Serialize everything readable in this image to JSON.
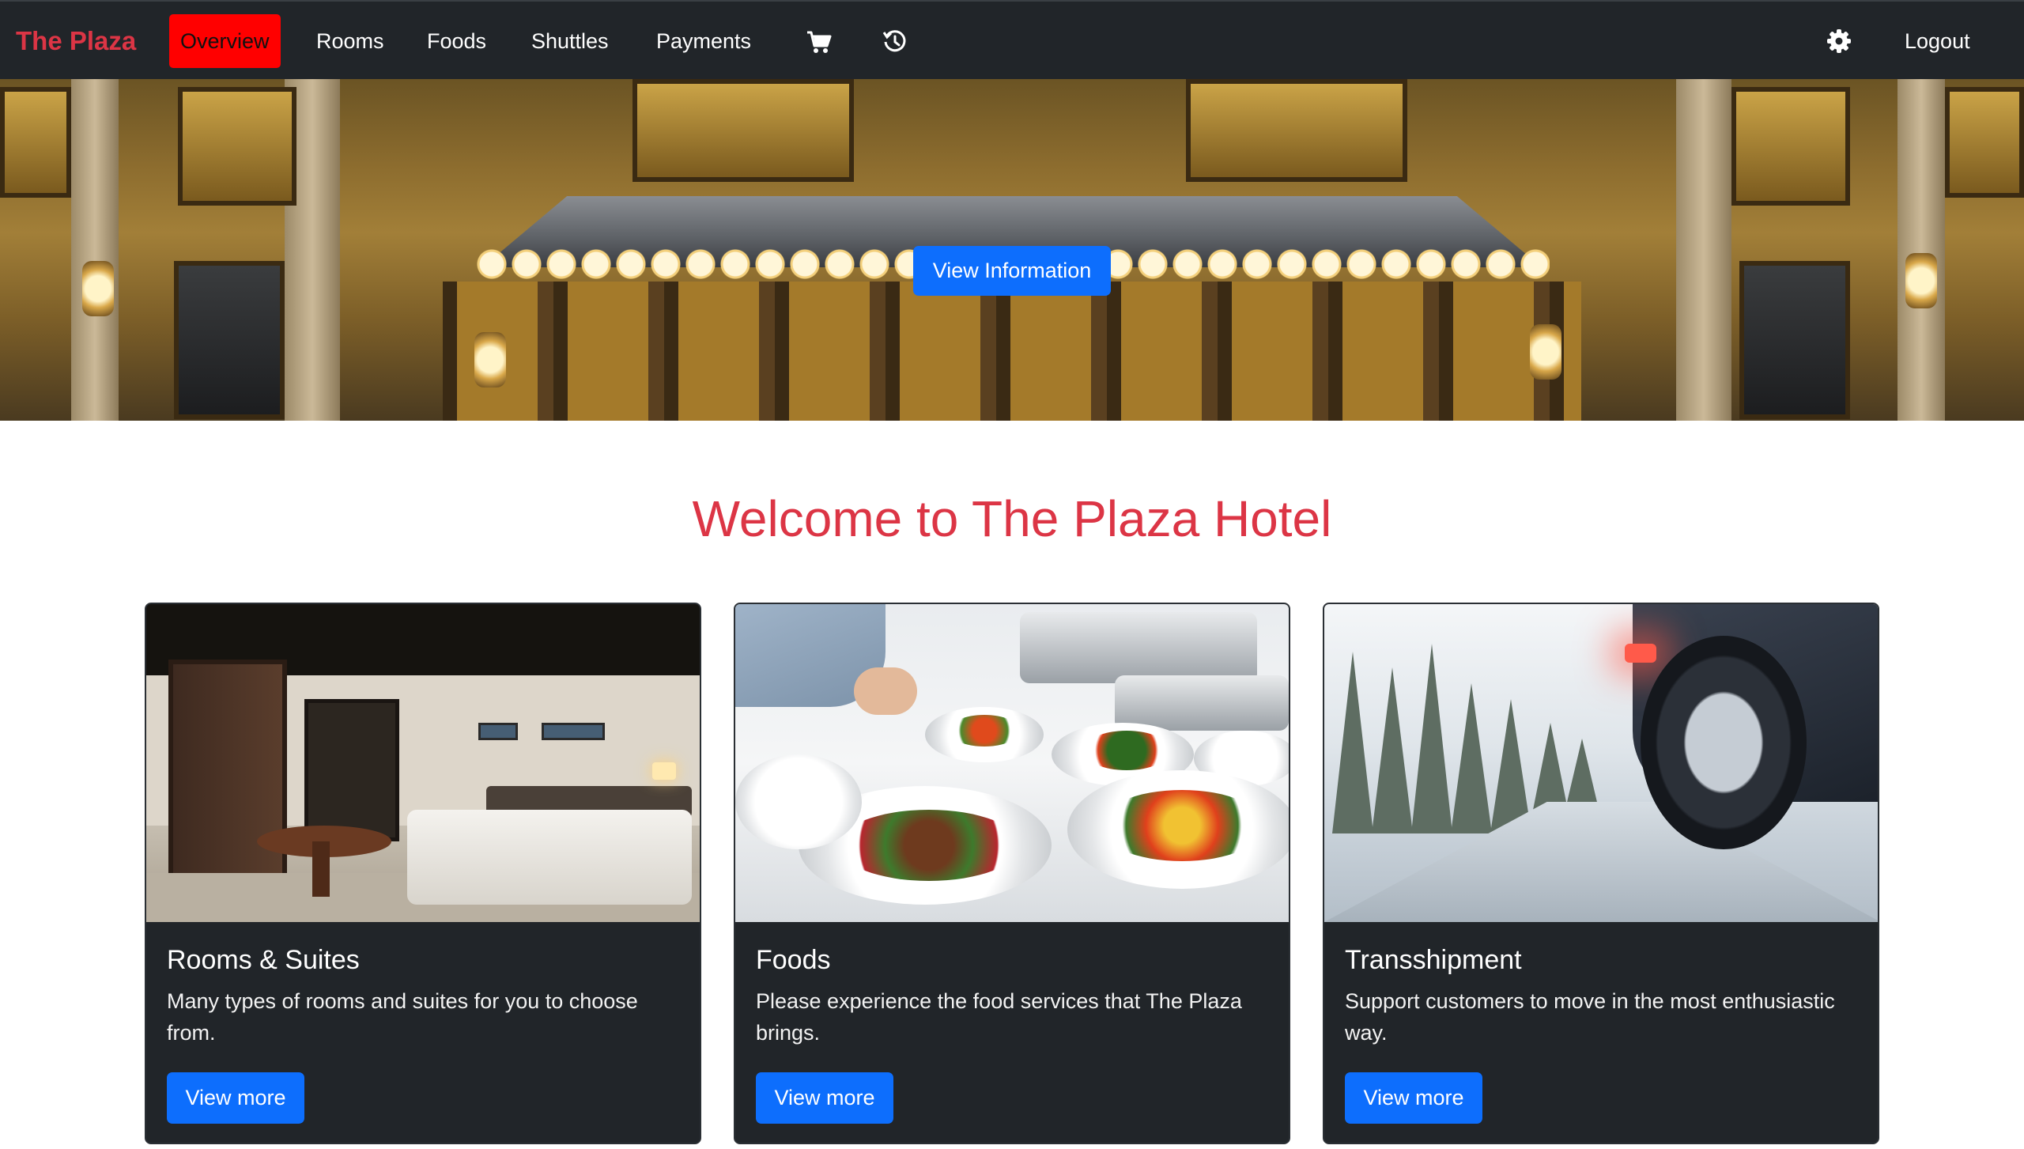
{
  "navbar": {
    "brand": "The Plaza",
    "items": [
      {
        "label": "Overview",
        "active": true
      },
      {
        "label": "Rooms",
        "active": false
      },
      {
        "label": "Foods",
        "active": false
      },
      {
        "label": "Shuttles",
        "active": false
      },
      {
        "label": "Payments",
        "active": false
      }
    ],
    "icons": [
      "cart-icon",
      "history-icon",
      "gear-icon"
    ],
    "logout_label": "Logout"
  },
  "hero": {
    "button_label": "View Information"
  },
  "welcome": {
    "title": "Welcome to The Plaza Hotel"
  },
  "cards": [
    {
      "title": "Rooms & Suites",
      "text": "Many types of rooms and suites for you to choose from.",
      "button_label": "View more"
    },
    {
      "title": "Foods",
      "text": "Please experience the food services that The Plaza brings.",
      "button_label": "View more"
    },
    {
      "title": "Transshipment",
      "text": "Support customers to move in the most enthusiastic way.",
      "button_label": "View more"
    }
  ],
  "colors": {
    "navbar_bg": "#212529",
    "brand": "#dc3545",
    "active_nav_bg": "#ff0000",
    "primary_button": "#0d6efd",
    "card_bg": "#212529",
    "welcome_title": "#dc3545"
  }
}
